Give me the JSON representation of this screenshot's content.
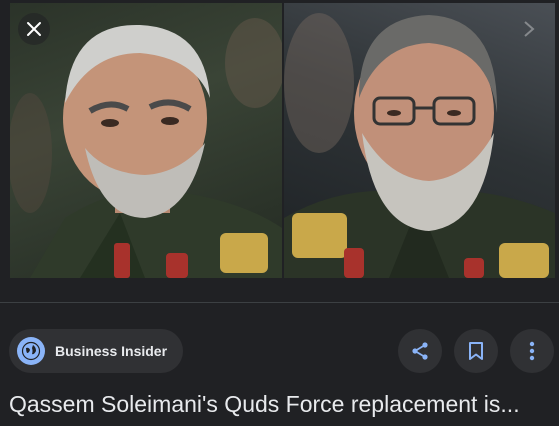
{
  "viewer": {
    "left_image": {
      "subject": "Qassem Soleimani portrait"
    },
    "right_image": {
      "subject": "Quds Force commander portrait"
    }
  },
  "source": {
    "name": "Business Insider",
    "logo": "globe-icon"
  },
  "actions": {
    "share": "share-icon",
    "save": "bookmark-icon",
    "more": "more-vert-icon"
  },
  "title": "Qassem Soleimani's Quds Force replacement is...",
  "colors": {
    "background": "#202124",
    "chip": "#303134",
    "text": "#e8eaed",
    "accent": "#8ab4f8"
  }
}
